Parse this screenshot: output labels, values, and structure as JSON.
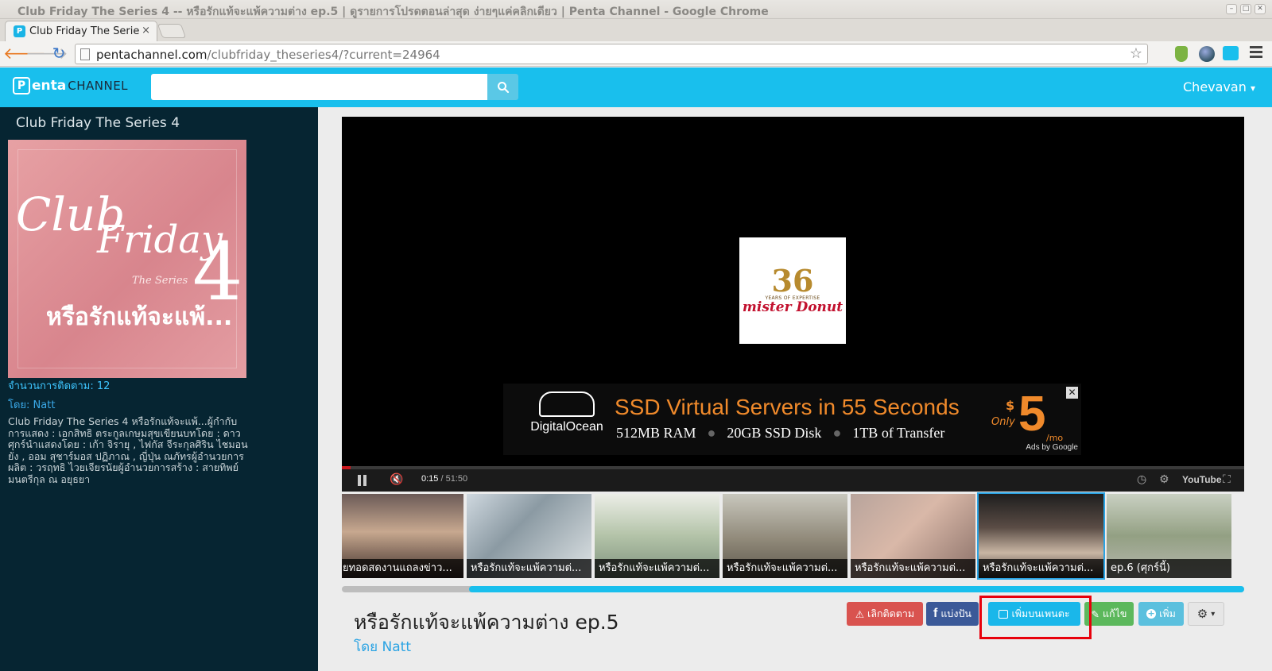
{
  "window": {
    "title": "Club Friday The Series 4 -- หรือรักแท้จะแพ้ความต่าง ep.5 | ดูรายการโปรดตอนล่าสุด ง่ายๆแค่คลิกเดียว | Penta Channel - Google Chrome"
  },
  "tab": {
    "label": "Club Friday The Series",
    "close": "×"
  },
  "toolbar": {
    "url_domain": "pentachannel.com",
    "url_path": "/clubfriday_theseries4/?current=24964"
  },
  "site": {
    "logo_word1": "enta",
    "logo_mark": "P",
    "logo_word2": "CHANNEL",
    "search_placeholder": "",
    "user_name": "Chevavan",
    "user_caret": "▾"
  },
  "sidebar": {
    "series_title": "Club Friday The Series 4",
    "cover": {
      "club": "Club",
      "friday": "Friday",
      "the_series": "The Series",
      "number": "4",
      "thai_title": "หรือรักแท้จะแพ้..."
    },
    "followers": "จำนวนการติดตาม: 12",
    "by": "โดย: Natt",
    "description": "Club Friday The Series 4 หรือรักแท้จะแพ้...ผู้กำกับการแสดง : เอกสิทธิ ตระกูลเกษมสุขเขียนบทโดย : ดาวศุกร์นำแสดงโดย : เก้า จิรายุ , ไฟกัส จีระกุลศิริน ไชมอน ยัง , ออม สุชาร์มอส ปฏิภาณ , ญี่ปุ่น ณภัทรผู้อำนวยการผลิต : วรฤทธิ ไวยเจียรนัยผู้อำนวยการสร้าง : สายทิพย์ มนตรีกุล ณ อยุธยา"
  },
  "player": {
    "sponsor_number": "36",
    "sponsor_tagline": "YEARS OF EXPERTISE",
    "sponsor_brand": "mister Donut",
    "ad": {
      "brand": "DigitalOcean",
      "headline": "SSD Virtual Servers in 55 Seconds",
      "spec1": "512MB RAM",
      "spec2": "20GB SSD Disk",
      "spec3": "1TB of Transfer",
      "only": "Only",
      "dollar": "$",
      "price": "5",
      "per": "/mo",
      "ads_by": "Ads by Google",
      "close": "✕"
    },
    "time_current": "0:15",
    "time_sep": " / ",
    "time_total": "51:50",
    "progress": 0.005,
    "youtube": "YouTube"
  },
  "episodes": [
    {
      "caption": "ยทอดสดงานแถลงข่าว..."
    },
    {
      "caption": "หรือรักแท้จะแพ้ความต่..."
    },
    {
      "caption": "หรือรักแท้จะแพ้ความต่..."
    },
    {
      "caption": "หรือรักแท้จะแพ้ความต่..."
    },
    {
      "caption": "หรือรักแท้จะแพ้ความต่..."
    },
    {
      "caption": "หรือรักแท้จะแพ้ความต่..."
    },
    {
      "caption": "ep.6 (ศุกร์นี้)"
    }
  ],
  "video": {
    "title": "หรือรักแท้จะแพ้ความต่าง ep.5",
    "author": "โดย Natt"
  },
  "actions": {
    "unfollow": "เลิกติดตาม",
    "share": "แบ่งปัน",
    "add_to_penta": "เพิ่มบนเพนตะ",
    "edit": "แก้ไข",
    "more": "เพิ่ม",
    "settings_caret": "▾"
  },
  "colors": {
    "brand": "#19bfed",
    "sidebar_bg": "#062532",
    "highlight": "#e8000b"
  }
}
